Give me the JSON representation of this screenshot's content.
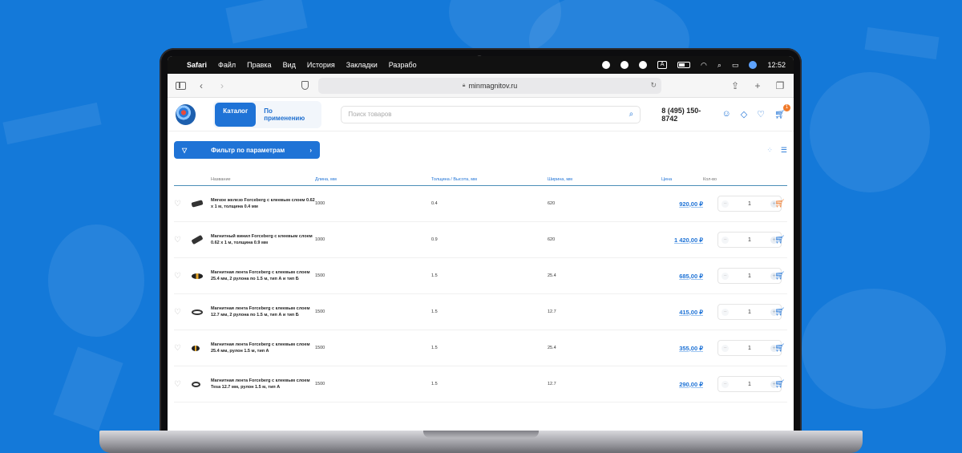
{
  "menubar": {
    "app": "Safari",
    "menus": [
      "Файл",
      "Правка",
      "Вид",
      "История",
      "Закладки",
      "Разрабо"
    ],
    "time": "12:52"
  },
  "safari": {
    "url": "minmagnitov.ru"
  },
  "header": {
    "catalog_label": "Каталог",
    "by_use_label": "По применению",
    "search_placeholder": "Поиск товаров",
    "phone": "8 (495) 150-8742",
    "cart_count": "1"
  },
  "filter": {
    "label": "Фильтр по параметрам",
    "chevron": "›"
  },
  "table": {
    "headers": {
      "name": "Название",
      "length": "Длина, мм",
      "thickness": "Толщина / Высота, мм",
      "width": "Ширина, мм",
      "price": "Цена",
      "qty": "Кол-во"
    },
    "rows": [
      {
        "name": "Мягкое железо Forceberg с клеевым слоем 0.62 х 1 м, толщина 0.4 мм",
        "length": "1000",
        "thickness": "0.4",
        "width": "620",
        "price": "920,00 ₽",
        "qty": "1",
        "img": "plate",
        "cart_color": "orange"
      },
      {
        "name": "Магнитный винил Forceberg с клеевым слоем 0.62 х 1 м, толщина 0.9 мм",
        "length": "1000",
        "thickness": "0.9",
        "width": "620",
        "price": "1 420,00 ₽",
        "qty": "1",
        "img": "plate",
        "cart_color": "blue"
      },
      {
        "name": "Магнитная лента Forceberg с клеевым слоем 25.4 мм, 2 рулона по 1.5 м, тип А и тип Б",
        "length": "1500",
        "thickness": "1.5",
        "width": "25.4",
        "price": "685,00 ₽",
        "qty": "1",
        "img": "rolls",
        "cart_color": "blue"
      },
      {
        "name": "Магнитная лента Forceberg с клеевым слоем 12.7 мм, 2 рулона по 1.5 м, тип А и тип Б",
        "length": "1500",
        "thickness": "1.5",
        "width": "12.7",
        "price": "415,00 ₽",
        "qty": "1",
        "img": "rolls",
        "cart_color": "blue"
      },
      {
        "name": "Магнитная лента Forceberg с клеевым слоем 25.4 мм, рулон 1.5 м, тип А",
        "length": "1500",
        "thickness": "1.5",
        "width": "25.4",
        "price": "355,00 ₽",
        "qty": "1",
        "img": "roll-yellow",
        "cart_color": "blue"
      },
      {
        "name": "Магнитная лента Forceberg с клеевым слоем Tesa 12.7 мм, рулон 1.5 м, тип А",
        "length": "1500",
        "thickness": "1.5",
        "width": "12.7",
        "price": "290,00 ₽",
        "qty": "1",
        "img": "roll",
        "cart_color": "blue"
      }
    ]
  },
  "colors": {
    "background": "#1479d9",
    "accent": "#1f73d6",
    "cart_badge": "#f07a2a"
  },
  "icons": [
    "apple-icon",
    "sidebar-icon",
    "back-icon",
    "forward-icon",
    "shield-icon",
    "lock-icon",
    "reload-icon",
    "share-icon",
    "new-tab-icon",
    "tabs-icon",
    "search-icon",
    "user-icon",
    "tag-icon",
    "heart-icon",
    "cart-icon",
    "filter-icon",
    "grid-view-icon",
    "list-view-icon",
    "minus-icon",
    "plus-icon"
  ]
}
